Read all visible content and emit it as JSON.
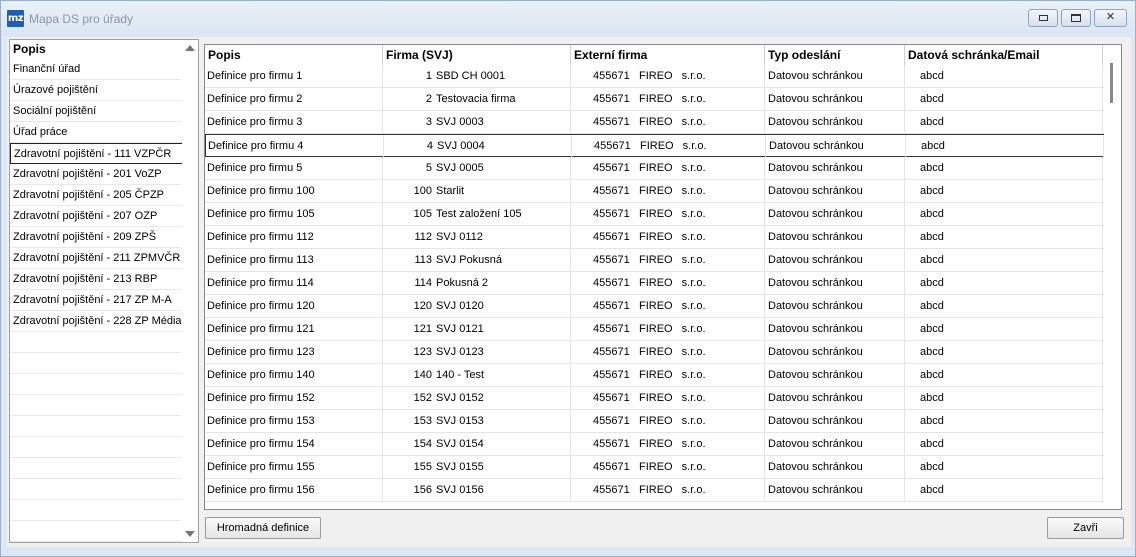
{
  "window": {
    "app_icon_text": "mz",
    "title": "Mapa DS pro úřady"
  },
  "left_panel": {
    "header": "Popis",
    "items": [
      "Finanční úřad",
      "Úrazové pojištění",
      "Sociální pojištění",
      "Úřad práce",
      "Zdravotní pojištění - 111 VZPČR",
      "Zdravotní pojištění - 201 VoZP",
      "Zdravotní pojištění - 205 ČPZP",
      "Zdravotní pojištění - 207 OZP",
      "Zdravotní pojištění - 209 ZPŠ",
      "Zdravotní pojištění - 211 ZPMVČR",
      "Zdravotní pojištění - 213 RBP",
      "Zdravotní pojištění - 217 ZP M-A",
      "Zdravotní pojištění - 228 ZP Média",
      "",
      "",
      "",
      "",
      "",
      "",
      "",
      "",
      "",
      "",
      ""
    ],
    "selected_index": 4
  },
  "grid": {
    "columns": [
      "Popis",
      "Firma (SVJ)",
      "Externí firma",
      "Typ odeslání",
      "Datová schránka/Email"
    ],
    "selected_index": 3,
    "rows": [
      {
        "popis": "Definice pro firmu 1",
        "firma_num": "1",
        "firma_name": "SBD CH 0001",
        "ext_num": "455671",
        "ext_name": "FIREO s.r.o.",
        "typ": "Datovou schránkou",
        "ds": "abcd"
      },
      {
        "popis": "Definice pro firmu 2",
        "firma_num": "2",
        "firma_name": "Testovacia firma",
        "ext_num": "455671",
        "ext_name": "FIREO s.r.o.",
        "typ": "Datovou schránkou",
        "ds": "abcd"
      },
      {
        "popis": "Definice pro firmu 3",
        "firma_num": "3",
        "firma_name": "SVJ 0003",
        "ext_num": "455671",
        "ext_name": "FIREO s.r.o.",
        "typ": "Datovou schránkou",
        "ds": "abcd"
      },
      {
        "popis": "Definice pro firmu 4",
        "firma_num": "4",
        "firma_name": "SVJ 0004",
        "ext_num": "455671",
        "ext_name": "FIREO s.r.o.",
        "typ": "Datovou schránkou",
        "ds": "abcd"
      },
      {
        "popis": "Definice pro firmu 5",
        "firma_num": "5",
        "firma_name": "SVJ 0005",
        "ext_num": "455671",
        "ext_name": "FIREO s.r.o.",
        "typ": "Datovou schránkou",
        "ds": "abcd"
      },
      {
        "popis": "Definice pro firmu 100",
        "firma_num": "100",
        "firma_name": "Starlit",
        "ext_num": "455671",
        "ext_name": "FIREO s.r.o.",
        "typ": "Datovou schránkou",
        "ds": "abcd"
      },
      {
        "popis": "Definice pro firmu 105",
        "firma_num": "105",
        "firma_name": "Test založení 105",
        "ext_num": "455671",
        "ext_name": "FIREO s.r.o.",
        "typ": "Datovou schránkou",
        "ds": "abcd"
      },
      {
        "popis": "Definice pro firmu 112",
        "firma_num": "112",
        "firma_name": "SVJ 0112",
        "ext_num": "455671",
        "ext_name": "FIREO s.r.o.",
        "typ": "Datovou schránkou",
        "ds": "abcd"
      },
      {
        "popis": "Definice pro firmu 113",
        "firma_num": "113",
        "firma_name": "SVJ Pokusná",
        "ext_num": "455671",
        "ext_name": "FIREO s.r.o.",
        "typ": "Datovou schránkou",
        "ds": "abcd"
      },
      {
        "popis": "Definice pro firmu 114",
        "firma_num": "114",
        "firma_name": "Pokusná 2",
        "ext_num": "455671",
        "ext_name": "FIREO s.r.o.",
        "typ": "Datovou schránkou",
        "ds": "abcd"
      },
      {
        "popis": "Definice pro firmu 120",
        "firma_num": "120",
        "firma_name": "SVJ 0120",
        "ext_num": "455671",
        "ext_name": "FIREO s.r.o.",
        "typ": "Datovou schránkou",
        "ds": "abcd"
      },
      {
        "popis": "Definice pro firmu 121",
        "firma_num": "121",
        "firma_name": "SVJ 0121",
        "ext_num": "455671",
        "ext_name": "FIREO s.r.o.",
        "typ": "Datovou schránkou",
        "ds": "abcd"
      },
      {
        "popis": "Definice pro firmu 123",
        "firma_num": "123",
        "firma_name": "SVJ 0123",
        "ext_num": "455671",
        "ext_name": "FIREO s.r.o.",
        "typ": "Datovou schránkou",
        "ds": "abcd"
      },
      {
        "popis": "Definice pro firmu 140",
        "firma_num": "140",
        "firma_name": "140 - Test",
        "ext_num": "455671",
        "ext_name": "FIREO s.r.o.",
        "typ": "Datovou schránkou",
        "ds": "abcd"
      },
      {
        "popis": "Definice pro firmu 152",
        "firma_num": "152",
        "firma_name": "SVJ 0152",
        "ext_num": "455671",
        "ext_name": "FIREO s.r.o.",
        "typ": "Datovou schránkou",
        "ds": "abcd"
      },
      {
        "popis": "Definice pro firmu 153",
        "firma_num": "153",
        "firma_name": "SVJ 0153",
        "ext_num": "455671",
        "ext_name": "FIREO s.r.o.",
        "typ": "Datovou schránkou",
        "ds": "abcd"
      },
      {
        "popis": "Definice pro firmu 154",
        "firma_num": "154",
        "firma_name": "SVJ 0154",
        "ext_num": "455671",
        "ext_name": "FIREO s.r.o.",
        "typ": "Datovou schránkou",
        "ds": "abcd"
      },
      {
        "popis": "Definice pro firmu 155",
        "firma_num": "155",
        "firma_name": "SVJ 0155",
        "ext_num": "455671",
        "ext_name": "FIREO s.r.o.",
        "typ": "Datovou schránkou",
        "ds": "abcd"
      },
      {
        "popis": "Definice pro firmu 156",
        "firma_num": "156",
        "firma_name": "SVJ 0156",
        "ext_num": "455671",
        "ext_name": "FIREO s.r.o.",
        "typ": "Datovou schránkou",
        "ds": "abcd"
      }
    ]
  },
  "buttons": {
    "hromadna": "Hromadná definice",
    "zavri": "Zavři"
  }
}
